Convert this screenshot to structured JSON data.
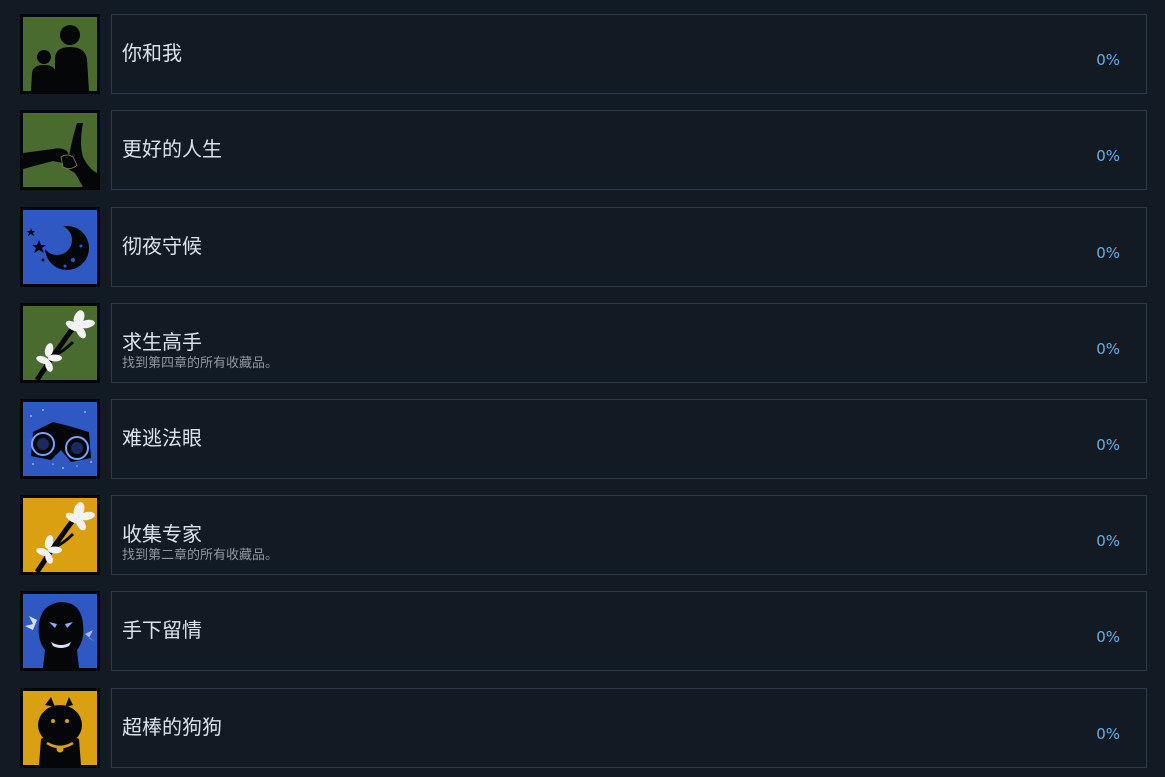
{
  "achievements": [
    {
      "title": "你和我",
      "description": "",
      "percent": "0%",
      "icon": "silhouette-adult-child-icon",
      "icon_bg": "#4a6b2f"
    },
    {
      "title": "更好的人生",
      "description": "",
      "percent": "0%",
      "icon": "holding-hands-icon",
      "icon_bg": "#4a6b2f"
    },
    {
      "title": "彻夜守候",
      "description": "",
      "percent": "0%",
      "icon": "crescent-moon-icon",
      "icon_bg": "#2f58c2"
    },
    {
      "title": "求生高手",
      "description": "找到第四章的所有收藏品。",
      "percent": "0%",
      "icon": "flower-branch-icon",
      "icon_bg": "#4a6b2f"
    },
    {
      "title": "难逃法眼",
      "description": "",
      "percent": "0%",
      "icon": "binoculars-icon",
      "icon_bg": "#2f58c2"
    },
    {
      "title": "收集专家",
      "description": "找到第二章的所有收藏品。",
      "percent": "0%",
      "icon": "flower-branch-icon",
      "icon_bg": "#d9a012"
    },
    {
      "title": "手下留情",
      "description": "",
      "percent": "0%",
      "icon": "zombie-face-icon",
      "icon_bg": "#2f58c2"
    },
    {
      "title": "超棒的狗狗",
      "description": "",
      "percent": "0%",
      "icon": "dog-icon",
      "icon_bg": "#d9a012"
    }
  ]
}
